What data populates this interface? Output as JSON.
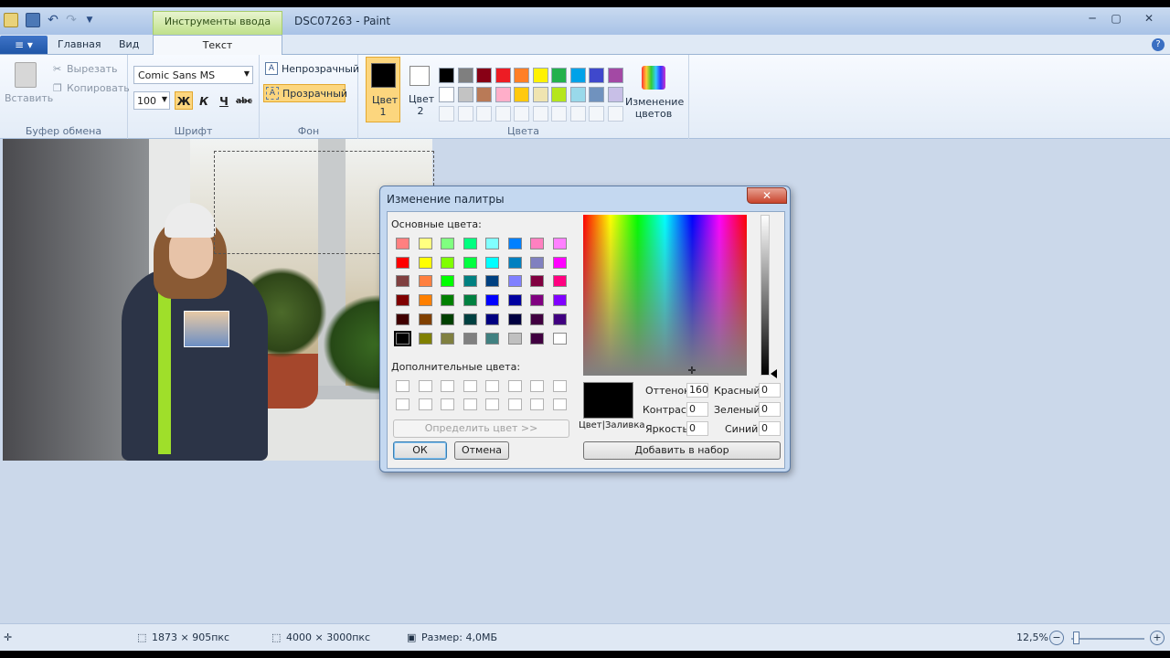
{
  "window": {
    "title": "DSC07263 - Paint",
    "context_tab": "Инструменты ввода текста"
  },
  "tabs": {
    "home": "Главная",
    "view": "Вид",
    "text": "Текст"
  },
  "ribbon": {
    "clipboard": {
      "paste": "Вставить",
      "cut": "Вырезать",
      "copy": "Копировать",
      "group_label": "Буфер обмена"
    },
    "font": {
      "family": "Comic Sans MS",
      "size": "100",
      "bold": "Ж",
      "italic": "К",
      "underline": "Ч",
      "strike": "abc",
      "group_label": "Шрифт"
    },
    "background": {
      "opaque": "Непрозрачный",
      "transparent": "Прозрачный",
      "group_label": "Фон"
    },
    "colors": {
      "color1": "Цвет 1",
      "color2": "Цвет 2",
      "edit": "Изменение цветов",
      "group_label": "Цвета",
      "palette_row1": [
        "#000000",
        "#7f7f7f",
        "#880015",
        "#ed1c24",
        "#ff7f27",
        "#fff200",
        "#22b14c",
        "#00a2e8",
        "#3f48cc",
        "#a349a4"
      ],
      "palette_row2": [
        "#ffffff",
        "#c3c3c3",
        "#b97a57",
        "#ffaec9",
        "#ffc90e",
        "#efe4b0",
        "#b5e61d",
        "#99d9ea",
        "#7092be",
        "#c8bfe7"
      ]
    }
  },
  "dialog": {
    "title": "Изменение палитры",
    "basic_colors_label": "Основные цвета:",
    "custom_colors_label": "Дополнительные цвета:",
    "define_button": "Определить цвет >>",
    "ok": "ОК",
    "cancel": "Отмена",
    "preview_label": "Цвет|Заливка",
    "add_button": "Добавить в набор",
    "hue_label": "Оттенок:",
    "hue": "160",
    "sat_label": "Контраст:",
    "sat": "0",
    "lum_label": "Яркость:",
    "lum": "0",
    "red_label": "Красный:",
    "red": "0",
    "green_label": "Зеленый:",
    "green": "0",
    "blue_label": "Синий:",
    "blue": "0",
    "basic_colors": [
      [
        "#ff8080",
        "#ffff80",
        "#80ff80",
        "#00ff80",
        "#80ffff",
        "#0080ff",
        "#ff80c0",
        "#ff80ff"
      ],
      [
        "#ff0000",
        "#ffff00",
        "#80ff00",
        "#00ff40",
        "#00ffff",
        "#0080c0",
        "#8080c0",
        "#ff00ff"
      ],
      [
        "#804040",
        "#ff8040",
        "#00ff00",
        "#008080",
        "#004080",
        "#8080ff",
        "#800040",
        "#ff0080"
      ],
      [
        "#800000",
        "#ff8000",
        "#008000",
        "#008040",
        "#0000ff",
        "#0000a0",
        "#800080",
        "#8000ff"
      ],
      [
        "#400000",
        "#804000",
        "#004000",
        "#004040",
        "#000080",
        "#000040",
        "#400040",
        "#400080"
      ],
      [
        "#000000",
        "#808000",
        "#808040",
        "#808080",
        "#408080",
        "#c0c0c0",
        "#400040",
        "#ffffff"
      ]
    ]
  },
  "status": {
    "selection_size": "1873 × 905пкс",
    "image_size": "4000 × 3000пкс",
    "file_size": "Размер: 4,0МБ",
    "zoom": "12,5%"
  }
}
